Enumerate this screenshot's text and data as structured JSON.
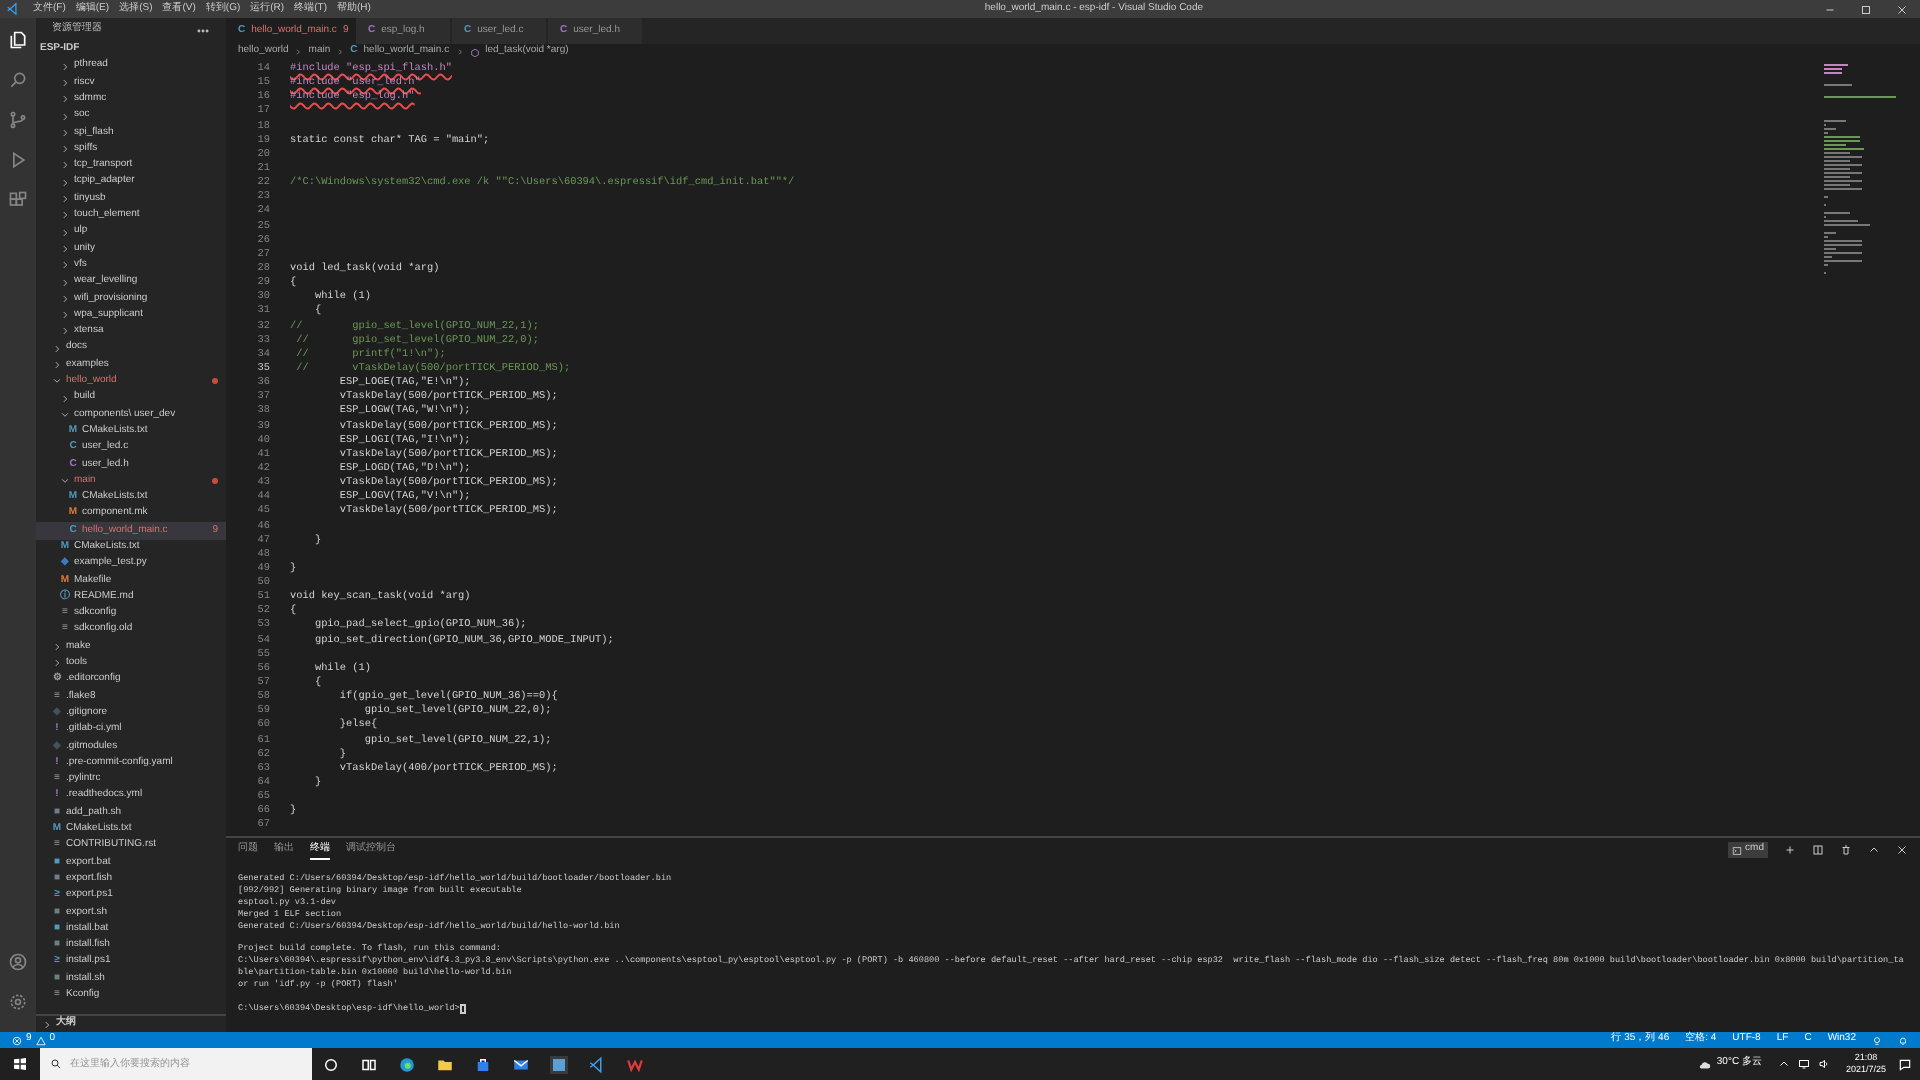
{
  "window": {
    "title": "hello_world_main.c - esp-idf - Visual Studio Code"
  },
  "menu": [
    "文件(F)",
    "编辑(E)",
    "选择(S)",
    "查看(V)",
    "转到(G)",
    "运行(R)",
    "终端(T)",
    "帮助(H)"
  ],
  "explorer": {
    "title": "资源管理器",
    "root": "ESP-IDF",
    "scrolled_items": [
      {
        "label": "pthread",
        "kind": "folder",
        "expanded": false
      },
      {
        "label": "riscv",
        "kind": "folder",
        "expanded": false
      },
      {
        "label": "sdmmc",
        "kind": "folder",
        "expanded": false
      },
      {
        "label": "soc",
        "kind": "folder",
        "expanded": false
      },
      {
        "label": "spi_flash",
        "kind": "folder",
        "expanded": false
      },
      {
        "label": "spiffs",
        "kind": "folder",
        "expanded": false
      },
      {
        "label": "tcp_transport",
        "kind": "folder",
        "expanded": false
      },
      {
        "label": "tcpip_adapter",
        "kind": "folder",
        "expanded": false
      },
      {
        "label": "tinyusb",
        "kind": "folder",
        "expanded": false
      },
      {
        "label": "touch_element",
        "kind": "folder",
        "expanded": false
      },
      {
        "label": "ulp",
        "kind": "folder",
        "expanded": false
      },
      {
        "label": "unity",
        "kind": "folder",
        "expanded": false
      },
      {
        "label": "vfs",
        "kind": "folder",
        "expanded": false
      },
      {
        "label": "wear_levelling",
        "kind": "folder",
        "expanded": false
      },
      {
        "label": "wifi_provisioning",
        "kind": "folder",
        "expanded": false
      },
      {
        "label": "wpa_supplicant",
        "kind": "folder",
        "expanded": false
      },
      {
        "label": "xtensa",
        "kind": "folder",
        "expanded": false
      }
    ],
    "items": [
      {
        "label": "docs",
        "kind": "folder",
        "expanded": false
      },
      {
        "label": "examples",
        "kind": "folder",
        "expanded": false
      },
      {
        "label": "hello_world",
        "kind": "folder",
        "expanded": true,
        "modified": true,
        "children": [
          {
            "label": "build",
            "kind": "folder",
            "expanded": false
          },
          {
            "label": "components\\ user_dev",
            "kind": "folder",
            "expanded": true,
            "children": [
              {
                "label": "CMakeLists.txt",
                "kind": "cmake",
                "glyph": "M"
              },
              {
                "label": "user_led.c",
                "kind": "c",
                "glyph": "C"
              },
              {
                "label": "user_led.h",
                "kind": "h",
                "glyph": "C"
              }
            ]
          },
          {
            "label": "main",
            "kind": "folder",
            "expanded": true,
            "modified": true,
            "children": [
              {
                "label": "CMakeLists.txt",
                "kind": "cmake",
                "glyph": "M"
              },
              {
                "label": "component.mk",
                "kind": "make",
                "glyph": "M"
              },
              {
                "label": "hello_world_main.c",
                "kind": "c",
                "glyph": "C",
                "selected": true,
                "modified": true,
                "problems": "9"
              }
            ]
          },
          {
            "label": "CMakeLists.txt",
            "kind": "cmake",
            "glyph": "M"
          },
          {
            "label": "example_test.py",
            "kind": "py",
            "glyph": "◆"
          },
          {
            "label": "Makefile",
            "kind": "make",
            "glyph": "M"
          },
          {
            "label": "README.md",
            "kind": "info",
            "glyph": "ⓘ"
          },
          {
            "label": "sdkconfig",
            "kind": "config",
            "glyph": "≡"
          },
          {
            "label": "sdkconfig.old",
            "kind": "config",
            "glyph": "≡"
          }
        ]
      },
      {
        "label": "make",
        "kind": "folder",
        "expanded": false
      },
      {
        "label": "tools",
        "kind": "folder",
        "expanded": false
      },
      {
        "label": ".editorconfig",
        "kind": "gear",
        "glyph": "⚙"
      },
      {
        "label": ".flake8",
        "kind": "config",
        "glyph": "≡"
      },
      {
        "label": ".gitignore",
        "kind": "git",
        "glyph": "◆"
      },
      {
        "label": ".gitlab-ci.yml",
        "kind": "yaml",
        "glyph": "!"
      },
      {
        "label": ".gitmodules",
        "kind": "git",
        "glyph": "◆"
      },
      {
        "label": ".pre-commit-config.yaml",
        "kind": "yaml",
        "glyph": "!"
      },
      {
        "label": ".pylintrc",
        "kind": "config",
        "glyph": "≡"
      },
      {
        "label": ".readthedocs.yml",
        "kind": "yaml",
        "glyph": "!"
      },
      {
        "label": "add_path.sh",
        "kind": "shell",
        "glyph": "■"
      },
      {
        "label": "CMakeLists.txt",
        "kind": "cmake",
        "glyph": "M"
      },
      {
        "label": "CONTRIBUTING.rst",
        "kind": "config",
        "glyph": "≡"
      },
      {
        "label": "export.bat",
        "kind": "bat",
        "glyph": "■"
      },
      {
        "label": "export.fish",
        "kind": "shell",
        "glyph": "■"
      },
      {
        "label": "export.ps1",
        "kind": "ps",
        "glyph": "≥"
      },
      {
        "label": "export.sh",
        "kind": "shell",
        "glyph": "■"
      },
      {
        "label": "install.bat",
        "kind": "bat",
        "glyph": "■"
      },
      {
        "label": "install.fish",
        "kind": "shell",
        "glyph": "■"
      },
      {
        "label": "install.ps1",
        "kind": "ps",
        "glyph": "≥"
      },
      {
        "label": "install.sh",
        "kind": "shell",
        "glyph": "■"
      },
      {
        "label": "Kconfig",
        "kind": "config",
        "glyph": "≡"
      }
    ],
    "outline": "大纲"
  },
  "tabs": [
    {
      "label": "hello_world_main.c",
      "glyph": "C",
      "kind": "c",
      "selected": true,
      "problems": "9"
    },
    {
      "label": "esp_log.h",
      "glyph": "C",
      "kind": "h",
      "selected": false
    },
    {
      "label": "user_led.c",
      "glyph": "C",
      "kind": "c",
      "selected": false
    },
    {
      "label": "user_led.h",
      "glyph": "C",
      "kind": "h",
      "selected": false
    }
  ],
  "breadcrumb": [
    {
      "label": "hello_world",
      "kind": "folder"
    },
    {
      "label": "main",
      "kind": "folder"
    },
    {
      "label": "hello_world_main.c",
      "kind": "c",
      "glyph": "C"
    },
    {
      "label": "led_task(void *arg)",
      "kind": "function"
    }
  ],
  "code": [
    {
      "n": "14",
      "kind": "include",
      "text": "#include \"esp_spi_flash.h\""
    },
    {
      "n": "15",
      "kind": "include",
      "text": "#include \"user_led.h\""
    },
    {
      "n": "16",
      "kind": "include",
      "text": "#include \"esp_log.h\""
    },
    {
      "n": "17",
      "kind": "code"
    },
    {
      "n": "18",
      "kind": "code"
    },
    {
      "n": "19",
      "kind": "code",
      "text": "static const char* TAG = \"main\";"
    },
    {
      "n": "20",
      "kind": "code"
    },
    {
      "n": "21",
      "kind": "code"
    },
    {
      "n": "22",
      "kind": "comment",
      "text": "/*C:\\Windows\\system32\\cmd.exe /k \"\"C:\\Users\\60394\\.espressif\\idf_cmd_init.bat\"\"*/"
    },
    {
      "n": "23",
      "kind": "code"
    },
    {
      "n": "24",
      "kind": "code"
    },
    {
      "n": "25",
      "kind": "code"
    },
    {
      "n": "26",
      "kind": "code"
    },
    {
      "n": "27",
      "kind": "code"
    },
    {
      "n": "28",
      "kind": "code",
      "text": "void led_task(void *arg)"
    },
    {
      "n": "29",
      "kind": "code",
      "text": "{"
    },
    {
      "n": "30",
      "kind": "code",
      "text": "    while (1)"
    },
    {
      "n": "31",
      "kind": "code",
      "text": "    {"
    },
    {
      "n": "32",
      "kind": "comment",
      "text": "//        gpio_set_level(GPIO_NUM_22,1);"
    },
    {
      "n": "33",
      "kind": "comment",
      "text": " //       gpio_set_level(GPIO_NUM_22,0);"
    },
    {
      "n": "34",
      "kind": "comment",
      "text": " //       printf(\"1!\\n\");"
    },
    {
      "n": "35",
      "kind": "comment",
      "text": " //       vTaskDelay(500/portTICK_PERIOD_MS);"
    },
    {
      "n": "36",
      "kind": "code",
      "text": "        ESP_LOGE(TAG,\"E!\\n\");"
    },
    {
      "n": "37",
      "kind": "code",
      "text": "        vTaskDelay(500/portTICK_PERIOD_MS);"
    },
    {
      "n": "38",
      "kind": "code",
      "text": "        ESP_LOGW(TAG,\"W!\\n\");"
    },
    {
      "n": "39",
      "kind": "code",
      "text": "        vTaskDelay(500/portTICK_PERIOD_MS);"
    },
    {
      "n": "40",
      "kind": "code",
      "text": "        ESP_LOGI(TAG,\"I!\\n\");"
    },
    {
      "n": "41",
      "kind": "code",
      "text": "        vTaskDelay(500/portTICK_PERIOD_MS);"
    },
    {
      "n": "42",
      "kind": "code",
      "text": "        ESP_LOGD(TAG,\"D!\\n\");"
    },
    {
      "n": "43",
      "kind": "code",
      "text": "        vTaskDelay(500/portTICK_PERIOD_MS);"
    },
    {
      "n": "44",
      "kind": "code",
      "text": "        ESP_LOGV(TAG,\"V!\\n\");"
    },
    {
      "n": "45",
      "kind": "code",
      "text": "        vTaskDelay(500/portTICK_PERIOD_MS);"
    },
    {
      "n": "46",
      "kind": "code"
    },
    {
      "n": "47",
      "kind": "code",
      "text": "    }"
    },
    {
      "n": "48",
      "kind": "code"
    },
    {
      "n": "49",
      "kind": "code",
      "text": "}"
    },
    {
      "n": "50",
      "kind": "code"
    },
    {
      "n": "51",
      "kind": "code",
      "text": "void key_scan_task(void *arg)"
    },
    {
      "n": "52",
      "kind": "code",
      "text": "{"
    },
    {
      "n": "53",
      "kind": "code",
      "text": "    gpio_pad_select_gpio(GPIO_NUM_36);"
    },
    {
      "n": "54",
      "kind": "code",
      "text": "    gpio_set_direction(GPIO_NUM_36,GPIO_MODE_INPUT);"
    },
    {
      "n": "55",
      "kind": "code"
    },
    {
      "n": "56",
      "kind": "code",
      "text": "    while (1)"
    },
    {
      "n": "57",
      "kind": "code",
      "text": "    {"
    },
    {
      "n": "58",
      "kind": "code",
      "text": "        if(gpio_get_level(GPIO_NUM_36)==0){"
    },
    {
      "n": "59",
      "kind": "code",
      "text": "            gpio_set_level(GPIO_NUM_22,0);"
    },
    {
      "n": "60",
      "kind": "code",
      "text": "        }else{"
    },
    {
      "n": "61",
      "kind": "code",
      "text": "            gpio_set_level(GPIO_NUM_22,1);"
    },
    {
      "n": "62",
      "kind": "code",
      "text": "        }"
    },
    {
      "n": "63",
      "kind": "code",
      "text": "        vTaskDelay(400/portTICK_PERIOD_MS);"
    },
    {
      "n": "64",
      "kind": "code",
      "text": "    }"
    },
    {
      "n": "65",
      "kind": "code"
    },
    {
      "n": "66",
      "kind": "code",
      "text": "}"
    },
    {
      "n": "67",
      "kind": "code"
    }
  ],
  "panel": {
    "tabs": [
      {
        "label": "问题",
        "selected": false
      },
      {
        "label": "输出",
        "selected": false
      },
      {
        "label": "终端",
        "selected": true
      },
      {
        "label": "调试控制台",
        "selected": false
      }
    ],
    "terminal_name": "cmd",
    "blocks": [
      [
        "Generated C:/Users/60394/Desktop/esp-idf/hello_world/build/bootloader/bootloader.bin",
        "[992/992] Generating binary image from built executable",
        "esptool.py v3.1-dev",
        "Merged 1 ELF section",
        "Generated C:/Users/60394/Desktop/esp-idf/hello_world/build/hello-world.bin"
      ],
      [
        "Project build complete. To flash, run this command:",
        "C:\\Users\\60394\\.espressif\\python_env\\idf4.3_py3.8_env\\Scripts\\python.exe ..\\components\\esptool_py\\esptool\\esptool.py -p (PORT) -b 460800 --before default_reset --after hard_reset --chip esp32  write_flash --flash_mode dio --flash_size detect --flash_freq 80m 0x1000 build\\bootloader\\bootloader.bin 0x8000 build\\partition_table\\partition-table.bin 0x10000 build\\hello-world.bin",
        "or run 'idf.py -p (PORT) flash'"
      ]
    ],
    "prompt": "C:\\Users\\60394\\Desktop\\esp-idf\\hello_world>"
  },
  "status_bar": {
    "errors": "9",
    "warnings": "0",
    "right": [
      "行 35，列 46",
      "空格: 4",
      "UTF-8",
      "LF",
      "C",
      "Win32"
    ]
  },
  "taskbar": {
    "search_placeholder": "在这里输入你要搜索的内容",
    "weather": "30°C 多云",
    "time": "21:08",
    "date": "2021/7/25"
  }
}
